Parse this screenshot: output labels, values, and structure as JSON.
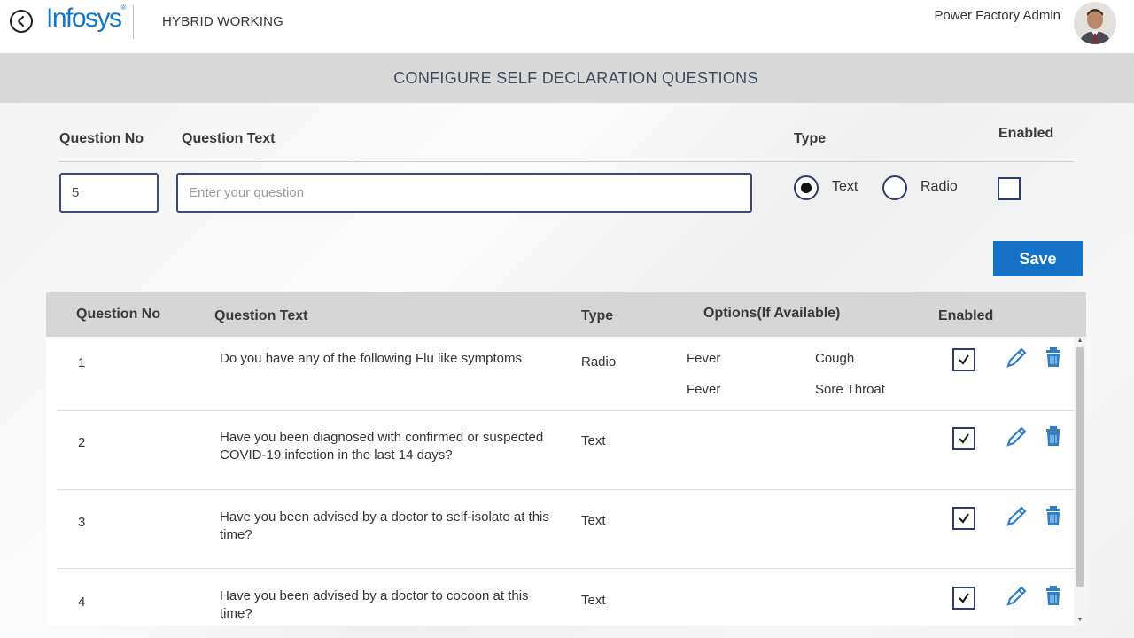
{
  "header": {
    "logo_text": "Infosys",
    "app_name": "HYBRID WORKING",
    "user_name": "Power Factory Admin"
  },
  "page": {
    "title": "CONFIGURE SELF DECLARATION QUESTIONS"
  },
  "form": {
    "labels": {
      "question_no": "Question No",
      "question_text": "Question Text",
      "type": "Type",
      "enabled": "Enabled"
    },
    "question_no_value": "5",
    "question_text_placeholder": "Enter your question",
    "type_options": [
      "Text",
      "Radio"
    ],
    "type_selected": "Text",
    "enabled_checked": false,
    "save_label": "Save"
  },
  "table": {
    "headers": {
      "question_no": "Question No",
      "question_text": "Question Text",
      "type": "Type",
      "options": "Options(If Available)",
      "enabled": "Enabled"
    },
    "rows": [
      {
        "no": "1",
        "text": "Do you have any of the following Flu like symptoms",
        "type": "Radio",
        "options": [
          "Fever",
          "Cough",
          "Fever",
          "Sore Throat"
        ],
        "enabled": true
      },
      {
        "no": "2",
        "text": "Have you been diagnosed with confirmed or suspected COVID-19 infection in the last 14 days?",
        "type": "Text",
        "options": [],
        "enabled": true
      },
      {
        "no": "3",
        "text": "Have you been advised by a doctor to self-isolate at this time?",
        "type": "Text",
        "options": [],
        "enabled": true
      },
      {
        "no": "4",
        "text": "Have you been advised by a doctor to cocoon at this time?",
        "type": "Text",
        "options": [],
        "enabled": true
      }
    ]
  },
  "colors": {
    "brand_blue": "#1476c6",
    "button_blue": "#1572c6",
    "title_band": "#d9d9d9",
    "table_header": "#d6d6d6",
    "action_icon": "#2f7fc8"
  },
  "icons": {
    "back": "back-arrow-circle-icon",
    "edit": "pencil-icon",
    "delete": "trash-icon",
    "check": "checkmark-icon"
  }
}
